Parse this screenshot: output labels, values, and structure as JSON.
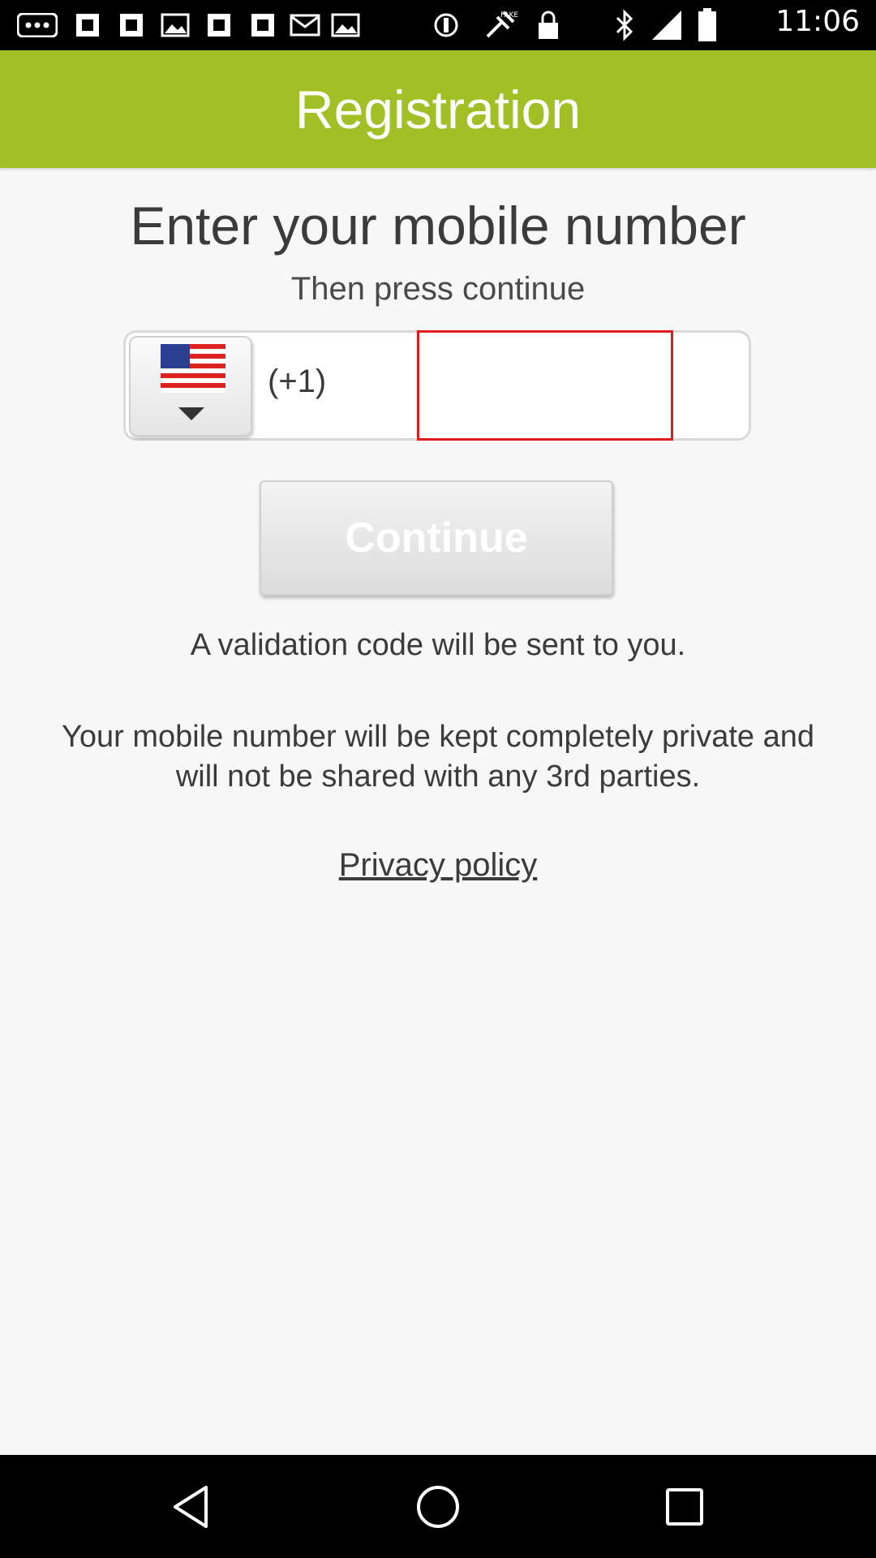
{
  "status_bar": {
    "time": "11:06",
    "icons": [
      "more-icon",
      "notification-icon",
      "notification-icon",
      "image-icon",
      "notification-icon",
      "sync-icon",
      "fake-gps-icon",
      "lock-icon",
      "bluetooth-icon",
      "signal-icon",
      "battery-icon"
    ]
  },
  "app_bar": {
    "title": "Registration"
  },
  "main": {
    "heading": "Enter your mobile number",
    "subheading": "Then press continue",
    "phone": {
      "dial_code": "(+1)",
      "value": "",
      "placeholder": "",
      "country_flag": "us-flag-icon"
    },
    "continue_label": "Continue",
    "info_line": "A validation code will be sent to you.",
    "privacy_note": "Your mobile number will be kept completely private and will not be shared with any 3rd parties.",
    "privacy_link": "Privacy policy"
  },
  "nav_bar": {
    "buttons": [
      "back-icon",
      "home-icon",
      "recents-icon"
    ]
  },
  "colors": {
    "accent": "#a2bf25",
    "highlight": "#e01b1b"
  }
}
